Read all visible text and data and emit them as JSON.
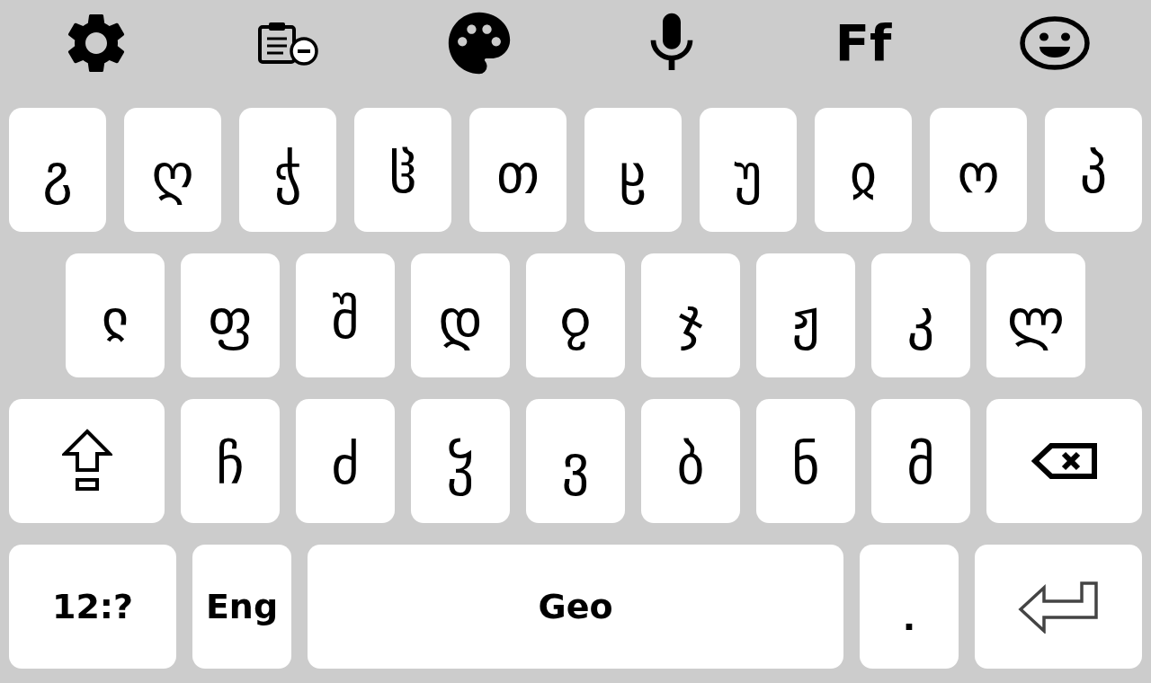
{
  "toolbar": [
    {
      "kind": "settings"
    },
    {
      "kind": "clipboard"
    },
    {
      "kind": "palette"
    },
    {
      "kind": "voice"
    },
    {
      "kind": "font",
      "label": "Ff"
    },
    {
      "kind": "emoji"
    }
  ],
  "rows": [
    {
      "keys": [
        {
          "kind": "letter",
          "label": "ჷ"
        },
        {
          "kind": "letter",
          "label": "ღ"
        },
        {
          "kind": "letter",
          "label": "ჭ"
        },
        {
          "kind": "letter",
          "label": "ჱ"
        },
        {
          "kind": "letter",
          "label": "თ"
        },
        {
          "kind": "letter",
          "label": "ჸ"
        },
        {
          "kind": "letter",
          "label": "უ"
        },
        {
          "kind": "letter",
          "label": "ჲ"
        },
        {
          "kind": "letter",
          "label": "ო"
        },
        {
          "kind": "letter",
          "label": "პ"
        }
      ]
    },
    {
      "keys": [
        {
          "kind": "letter",
          "label": "ჺ"
        },
        {
          "kind": "letter",
          "label": "ფ"
        },
        {
          "kind": "letter",
          "label": "შ"
        },
        {
          "kind": "letter",
          "label": "დ"
        },
        {
          "kind": "letter",
          "label": "ჹ"
        },
        {
          "kind": "letter",
          "label": "ჯ"
        },
        {
          "kind": "letter",
          "label": "ჟ"
        },
        {
          "kind": "letter",
          "label": "კ"
        },
        {
          "kind": "letter",
          "label": "ლ"
        }
      ]
    },
    {
      "keys": [
        {
          "kind": "shift"
        },
        {
          "kind": "letter",
          "label": "ჩ"
        },
        {
          "kind": "letter",
          "label": "ძ"
        },
        {
          "kind": "letter",
          "label": "ჴ"
        },
        {
          "kind": "letter",
          "label": "ვ"
        },
        {
          "kind": "letter",
          "label": "ბ"
        },
        {
          "kind": "letter",
          "label": "ნ"
        },
        {
          "kind": "letter",
          "label": "მ"
        },
        {
          "kind": "backspace"
        }
      ]
    },
    {
      "keys": [
        {
          "kind": "symbols",
          "label": "12:?"
        },
        {
          "kind": "language",
          "label": "Eng"
        },
        {
          "kind": "space",
          "label": "Geo"
        },
        {
          "kind": "punct",
          "label": "."
        },
        {
          "kind": "enter"
        }
      ]
    }
  ]
}
